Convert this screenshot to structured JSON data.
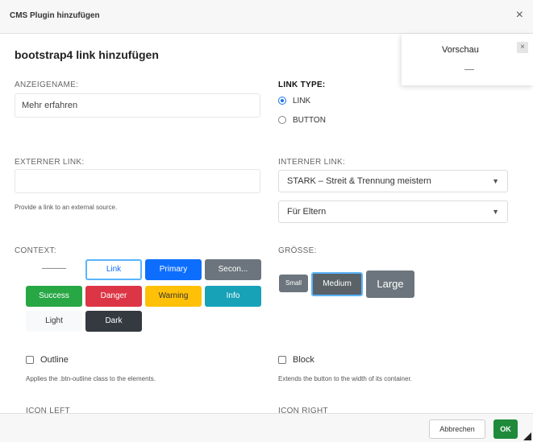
{
  "window": {
    "title": "CMS Plugin hinzufügen",
    "close_icon": "×"
  },
  "dialog": {
    "heading": "bootstrap4 link hinzufügen"
  },
  "preview": {
    "label": "Vorschau",
    "close_icon": "×"
  },
  "form": {
    "display_name": {
      "label": "ANZEIGENAME:",
      "value": "Mehr erfahren"
    },
    "link_type": {
      "label": "LINK TYPE:",
      "options": [
        "LINK",
        "BUTTON"
      ],
      "selected": "LINK"
    },
    "external_link": {
      "label": "EXTERNER LINK:",
      "value": "",
      "help": "Provide a link to an external source."
    },
    "internal_link": {
      "label": "INTERNER LINK:",
      "value": "STARK – Streit & Trennung meistern",
      "sub_value": "Für Eltern"
    },
    "context": {
      "label": "CONTEXT:",
      "options": [
        "———",
        "Link",
        "Primary",
        "Secon...",
        "Success",
        "Danger",
        "Warning",
        "Info",
        "Light",
        "Dark"
      ],
      "selected": "Link"
    },
    "size": {
      "label": "GRÖSSE:",
      "options": [
        "Small",
        "Medium",
        "Large"
      ],
      "selected": "Medium"
    },
    "outline": {
      "label": "Outline",
      "help": "Applies the .btn-outline class to the elements.",
      "checked": false
    },
    "block": {
      "label": "Block",
      "help": "Extends the button to the width of its container.",
      "checked": false
    },
    "icon_left_label": "ICON LEFT",
    "icon_right_label": "ICON RIGHT"
  },
  "footer": {
    "cancel_label": "Abbrechen",
    "ok_label": "OK"
  },
  "colors": {
    "primary": "#0d6efd",
    "success": "#28a745",
    "danger": "#dc3545",
    "warning": "#ffc107",
    "info": "#17a2b8",
    "secondary": "#6c757d",
    "dark": "#343a40",
    "ok_button": "#1f8a3a"
  }
}
